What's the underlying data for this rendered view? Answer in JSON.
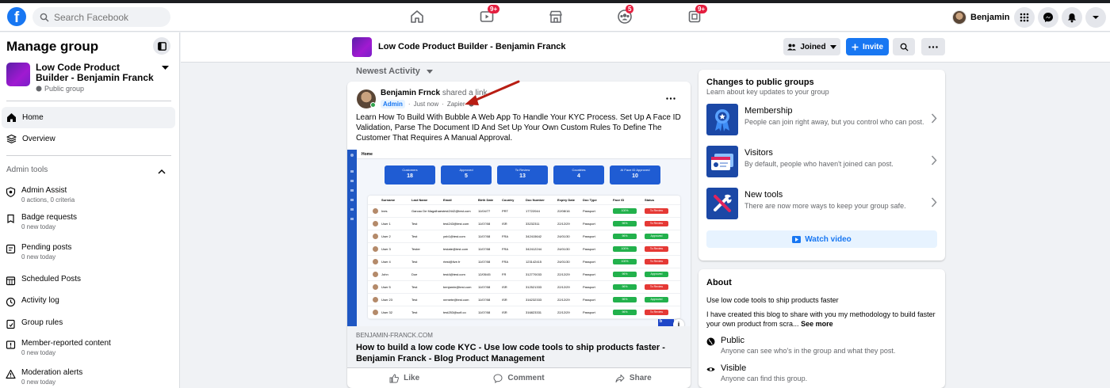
{
  "topbar": {
    "search_placeholder": "Search Facebook",
    "nav_badges": [
      "9+",
      "5",
      "9+"
    ],
    "profile_name": "Benjamin"
  },
  "sidebar": {
    "title": "Manage group",
    "group_name": "Low Code Product Builder - Benjamin Franck",
    "group_privacy": "Public group",
    "nav": [
      {
        "label": "Home",
        "icon": "home-icon"
      },
      {
        "label": "Overview",
        "icon": "overview-icon"
      }
    ],
    "admin_tools_label": "Admin tools",
    "tools": [
      {
        "label": "Admin Assist",
        "sub": "0 actions, 0 criteria",
        "icon": "shield-icon"
      },
      {
        "label": "Badge requests",
        "sub": "0 new today",
        "icon": "badge-icon"
      },
      {
        "label": "Pending posts",
        "sub": "0 new today",
        "icon": "pending-icon"
      },
      {
        "label": "Scheduled Posts",
        "sub": "",
        "icon": "calendar-icon"
      },
      {
        "label": "Activity log",
        "sub": "",
        "icon": "clock-icon"
      },
      {
        "label": "Group rules",
        "sub": "",
        "icon": "rules-icon"
      },
      {
        "label": "Member-reported content",
        "sub": "0 new today",
        "icon": "report-icon"
      },
      {
        "label": "Moderation alerts",
        "sub": "0 new today",
        "icon": "alert-icon"
      }
    ]
  },
  "group_header": {
    "title": "Low Code Product Builder - Benjamin Franck",
    "joined_label": "Joined",
    "invite_label": "Invite"
  },
  "feed": {
    "sort_label": "Newest Activity",
    "post": {
      "author": "Benjamin Frnck",
      "action": "shared a link.",
      "badge": "Admin",
      "time": "Just now",
      "via": "Zapier",
      "text": "Learn How To Build With Bubble A Web App To Handle Your KYC Process. Set Up A Face ID Validation, Parse The Document ID And Set Up Your Own Custom Rules To Define The Customer That Requires A Manual Approval.",
      "preview": {
        "page_title": "Home",
        "kpis": [
          {
            "label": "Customers",
            "value": "18"
          },
          {
            "label": "Approved",
            "value": "5"
          },
          {
            "label": "To Review",
            "value": "13"
          },
          {
            "label": "Countries",
            "value": "4"
          },
          {
            "label": "AI Face ID Approved",
            "value": "10"
          }
        ],
        "columns": [
          "Surname",
          "Last Name",
          "Email",
          "Birth Date",
          "Country",
          "Doc Number",
          "Expiry Date",
          "Doc Type",
          "Face ID",
          "Status"
        ],
        "rows": [
          [
            "Ines",
            "Garcao De Magalhaes",
            "test2442@test.com",
            "11/04/77",
            "PRT",
            "17722044",
            "22/08/16",
            "Passport",
            "100%",
            "To Review"
          ],
          [
            "User 1",
            "Test",
            "test243@test.com",
            "11/07/08",
            "ISR",
            "33232311",
            "22/12/29",
            "Passport",
            "96%",
            "To Review"
          ],
          [
            "User 2",
            "Test",
            "ynb1@test.com",
            "11/07/08",
            "FRA",
            "342415642",
            "24/01/30",
            "Passport",
            "96%",
            "Approved"
          ],
          [
            "User 3",
            "Tester",
            "testate@test.com",
            "11/07/08",
            "FRA",
            "342412244",
            "24/01/30",
            "Passport",
            "100%",
            "To Review"
          ],
          [
            "User 4",
            "Test",
            "rtest@live.fr",
            "11/07/08",
            "FRA",
            "123142415",
            "24/01/30",
            "Passport",
            "100%",
            "To Review"
          ],
          [
            "John",
            "Doe",
            "test4@test.com",
            "12/05/45",
            "FR",
            "312770033",
            "22/12/29",
            "Passport",
            "96%",
            "Approved"
          ],
          [
            "User 5",
            "Test",
            "benjamin@test.com",
            "11/07/08",
            "ISR",
            "312521333",
            "22/12/29",
            "Passport",
            "96%",
            "To Review"
          ],
          [
            "User 23",
            "Test",
            "nemete@test.com",
            "11/07/08",
            "ISR",
            "316232333",
            "22/12/29",
            "Passport",
            "96%",
            "Approved"
          ],
          [
            "User 32",
            "Test",
            "test253@sofi.co",
            "11/07/08",
            "ISR",
            "316823331",
            "22/12/29",
            "Passport",
            "96%",
            "To Review"
          ]
        ]
      },
      "link_domain": "BENJAMIN-FRANCK.COM",
      "link_title": "How to build a low code KYC - Use low code tools to ship products faster - Benjamin Franck - Blog Product Management",
      "actions": {
        "like": "Like",
        "comment": "Comment",
        "share": "Share"
      }
    }
  },
  "changes": {
    "title": "Changes to public groups",
    "subtitle": "Learn about key updates to your group",
    "items": [
      {
        "name": "Membership",
        "desc": "People can join right away, but you control who can post.",
        "icon": "membership-ribbon-icon"
      },
      {
        "name": "Visitors",
        "desc": "By default, people who haven't joined can post.",
        "icon": "visitors-card-icon"
      },
      {
        "name": "New tools",
        "desc": "There are now more ways to keep your group safe.",
        "icon": "tools-icon"
      }
    ],
    "watch_label": "Watch video"
  },
  "about": {
    "title": "About",
    "line1": "Use low code tools to ship products faster",
    "line2": "I have created this blog to share with you my methodology to build faster your own product from scra...",
    "see_more": "See more",
    "public_title": "Public",
    "public_desc": "Anyone can see who's in the group and what they post.",
    "visible_title": "Visible",
    "visible_desc": "Anyone can find this group."
  },
  "colors": {
    "brand": "#1877f2",
    "badge_red": "#e41e3f",
    "approved": "#22b14c",
    "review": "#e53935"
  }
}
